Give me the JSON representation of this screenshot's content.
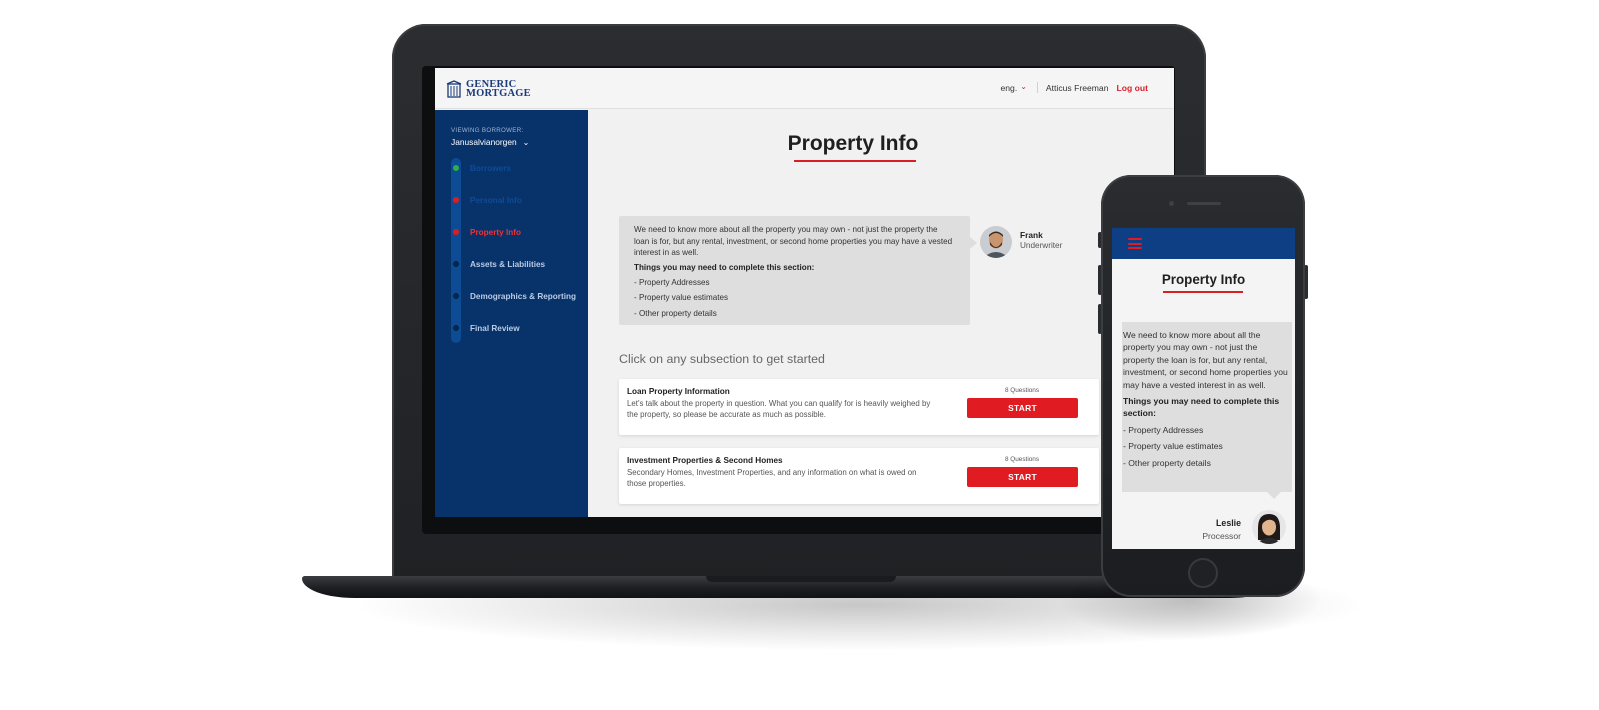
{
  "brand": {
    "logo_line1": "GENERIC",
    "logo_line2": "MORTGAGE",
    "color_navy": "#08326a",
    "color_accent": "#e11b22"
  },
  "header": {
    "language": "eng.",
    "user_name": "Atticus Freeman",
    "logout_label": "Log out"
  },
  "sidebar": {
    "viewing_label": "VIEWING BORROWER:",
    "borrower_name": "Janusalvianorgen",
    "steps": [
      {
        "label": "Borrowers",
        "state": "complete",
        "dot_color": "#2fae49"
      },
      {
        "label": "Personal Info",
        "state": "complete",
        "dot_color": "#e11b22"
      },
      {
        "label": "Property Info",
        "state": "active",
        "dot_color": "#e11b22"
      },
      {
        "label": "Assets & Liabilities",
        "state": "upcoming",
        "dot_color": "#06254f"
      },
      {
        "label": "Demographics & Reporting",
        "state": "upcoming",
        "dot_color": "#06254f"
      },
      {
        "label": "Final Review",
        "state": "upcoming",
        "dot_color": "#06254f"
      }
    ]
  },
  "main": {
    "title": "Property Info",
    "intro_text": "We need to know more about all the property you may own - not just the property the loan is for, but any rental, investment, or second home properties you may have a vested interest in as well.",
    "things_heading": "Things you may need to complete this section:",
    "things": [
      "- Property Addresses",
      "- Property value estimates",
      "- Other property details"
    ],
    "agent": {
      "name": "Frank",
      "role": "Underwriter"
    },
    "subsection_hint": "Click on any subsection to get started",
    "subsections": [
      {
        "title": "Loan Property Information",
        "description": "Let's talk about the property in question.  What you can qualify for is heavily weighed by the property, so please be accurate as much as possible.",
        "questions": "8 Questions",
        "button": "START"
      },
      {
        "title": "Investment Properties & Second Homes",
        "description": "Secondary Homes, Investment Properties, and any information on what is owed on those properties.",
        "questions": "8 Questions",
        "button": "START"
      }
    ]
  },
  "mobile": {
    "menu_icon": "hamburger-icon",
    "title": "Property Info",
    "intro_text": "We need to know more about all the property you may own - not just the property the loan is for, but any rental, investment, or second home properties you may have a vested interest in as well.",
    "things_heading": "Things you may need to complete this section:",
    "things": [
      "- Property Addresses",
      "- Property value estimates",
      "- Other property details"
    ],
    "agent": {
      "name": "Leslie",
      "role": "Processor"
    }
  }
}
